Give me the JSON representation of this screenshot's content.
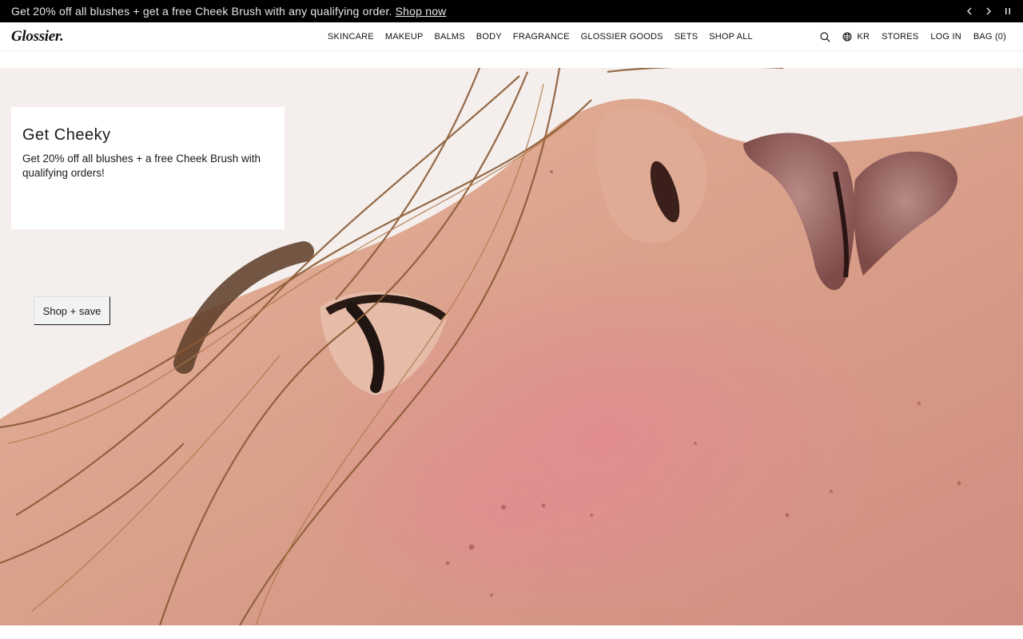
{
  "announcement": {
    "message": "Get 20% off all blushes + get a free Cheek Brush with any qualifying order.",
    "link": "Shop now"
  },
  "header": {
    "logo": "Glossier.",
    "nav": [
      "SKINCARE",
      "MAKEUP",
      "BALMS",
      "BODY",
      "FRAGRANCE",
      "GLOSSIER GOODS",
      "SETS",
      "SHOP ALL"
    ],
    "region": "KR",
    "stores": "STORES",
    "login": "LOG IN",
    "bag": "BAG (0)"
  },
  "promo": {
    "title": "Get Cheeky",
    "body": "Get 20% off all blushes + a free Cheek Brush with qualifying orders!",
    "cta": "Shop + save"
  },
  "icons": {
    "prev": "chevron-left-icon",
    "next": "chevron-right-icon",
    "pause": "pause-icon",
    "search": "search-icon",
    "globe": "globe-icon"
  },
  "colors": {
    "announcement_bg": "#000000",
    "text": "#1a1a1a",
    "button_bg": "#f2f2f2",
    "skin": "#d7a38c",
    "cheek": "#d98d92"
  }
}
